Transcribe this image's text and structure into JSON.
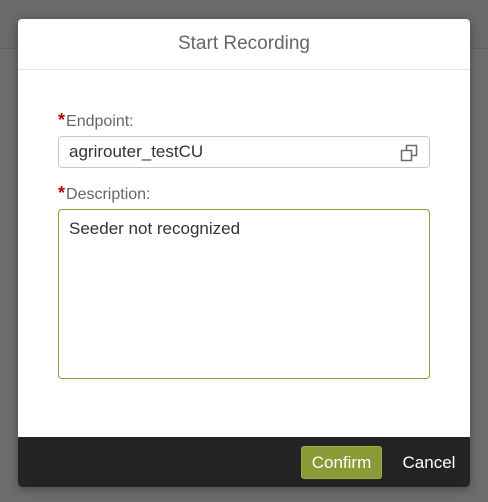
{
  "dialog": {
    "title": "Start Recording",
    "endpoint": {
      "required_mark": "*",
      "label": "Endpoint:",
      "value": "agrirouter_testCU",
      "icon": "copy-icon"
    },
    "description": {
      "required_mark": "*",
      "label": "Description:",
      "value": "Seeder not recognized"
    },
    "footer": {
      "confirm_label": "Confirm",
      "cancel_label": "Cancel"
    }
  },
  "colors": {
    "accent": "#8a9a34",
    "required": "#bb0000",
    "footer_bg": "#232323"
  }
}
